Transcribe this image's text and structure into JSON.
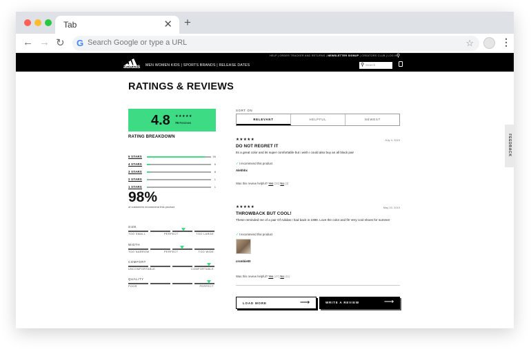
{
  "browser": {
    "tab_title": "Tab",
    "tab_close": "✕",
    "new_tab": "+",
    "omnibox_placeholder": "Search Google or type a URL",
    "back": "←",
    "forward": "→",
    "reload": "↻",
    "star": "☆",
    "menu": "⋮",
    "google_g": "G",
    "traffic_colors": [
      "#ff5f57",
      "#febc2e",
      "#28c840"
    ]
  },
  "site": {
    "logo_text": "adidas",
    "top_links": [
      "HELP",
      "ORDER TRACKER AND RETURNS",
      "NEWSLETTER SIGNUP",
      "CREATORS CLUB",
      "LOG IN"
    ],
    "nav_items": [
      "MEN",
      "WOMEN",
      "KIDS",
      "SPORTS",
      "BRANDS",
      "RELEASE DATES"
    ],
    "search_placeholder": "Search",
    "accent": "#3ddc84"
  },
  "ratings": {
    "title": "RATINGS & REVIEWS",
    "score": "4.8",
    "score_stars": "★★★★★",
    "review_count": "76",
    "review_count_label": "Reviews",
    "breakdown_title": "RATING BREAKDOWN",
    "breakdown": [
      {
        "label": "5 STARS",
        "count": "59",
        "fraction": 0.9
      },
      {
        "label": "4 STARS",
        "count": "6",
        "fraction": 0.04
      },
      {
        "label": "3 STARS",
        "count": "8",
        "fraction": 0.04
      },
      {
        "label": "2 STARS",
        "count": "1",
        "fraction": 0.01
      },
      {
        "label": "1 STARS",
        "count": "1",
        "fraction": 0.01
      }
    ],
    "recommend_pct": "98%",
    "recommend_text": "of customers recommend this product",
    "fit": [
      {
        "title": "SIZE",
        "left": "TOO SMALL",
        "middle": "PERFECT",
        "right": "TOO LARGE",
        "level": 0.65
      },
      {
        "title": "WIDTH",
        "left": "TOO NARROW",
        "middle": "PERFECT",
        "right": "TOO WIDE",
        "level": 0.63
      },
      {
        "title": "COMFORT",
        "left": "UNCOMFORTABLE",
        "middle": "",
        "right": "COMFORTABLE",
        "level": 0.95
      },
      {
        "title": "QUALITY",
        "left": "POOR",
        "middle": "",
        "right": "PERFECT",
        "level": 0.95
      }
    ]
  },
  "sort": {
    "label": "SORT ON",
    "options": [
      "RELEVANT",
      "HELPFUL",
      "NEWEST"
    ],
    "active": 0
  },
  "reviews": [
    {
      "stars": "★★★★★",
      "date": "July 4, 2019",
      "title": "DO NOT REGRET IT",
      "body": "Its a great color and its super comfortable but i wish i could also buy an all black pair",
      "recommend": "I recommend this product",
      "author": "Alehhhx",
      "helpful_q": "Was this review helpful?",
      "yes": "Yes",
      "yes_count": "(34)",
      "no": "No",
      "no_count": "(3)"
    },
    {
      "stars": "★★★★★",
      "date": "May 20, 2019",
      "title": "THROWBACK BUT COOL!",
      "body": "These reminded me of a pair Of Adidas I had back in 1999. Love the color and fit! Very cool shoes for summer",
      "recommend": "I recommend this product",
      "author": "crombie00",
      "helpful_q": "Was this review helpful?",
      "yes": "Yes",
      "yes_count": "(47)",
      "no": "No",
      "no_count": "(11)"
    }
  ],
  "buttons": {
    "load_more": "LOAD MORE",
    "write_review": "WRITE A REVIEW",
    "arrow": "⟶"
  },
  "feedback": "FEEDBACK"
}
